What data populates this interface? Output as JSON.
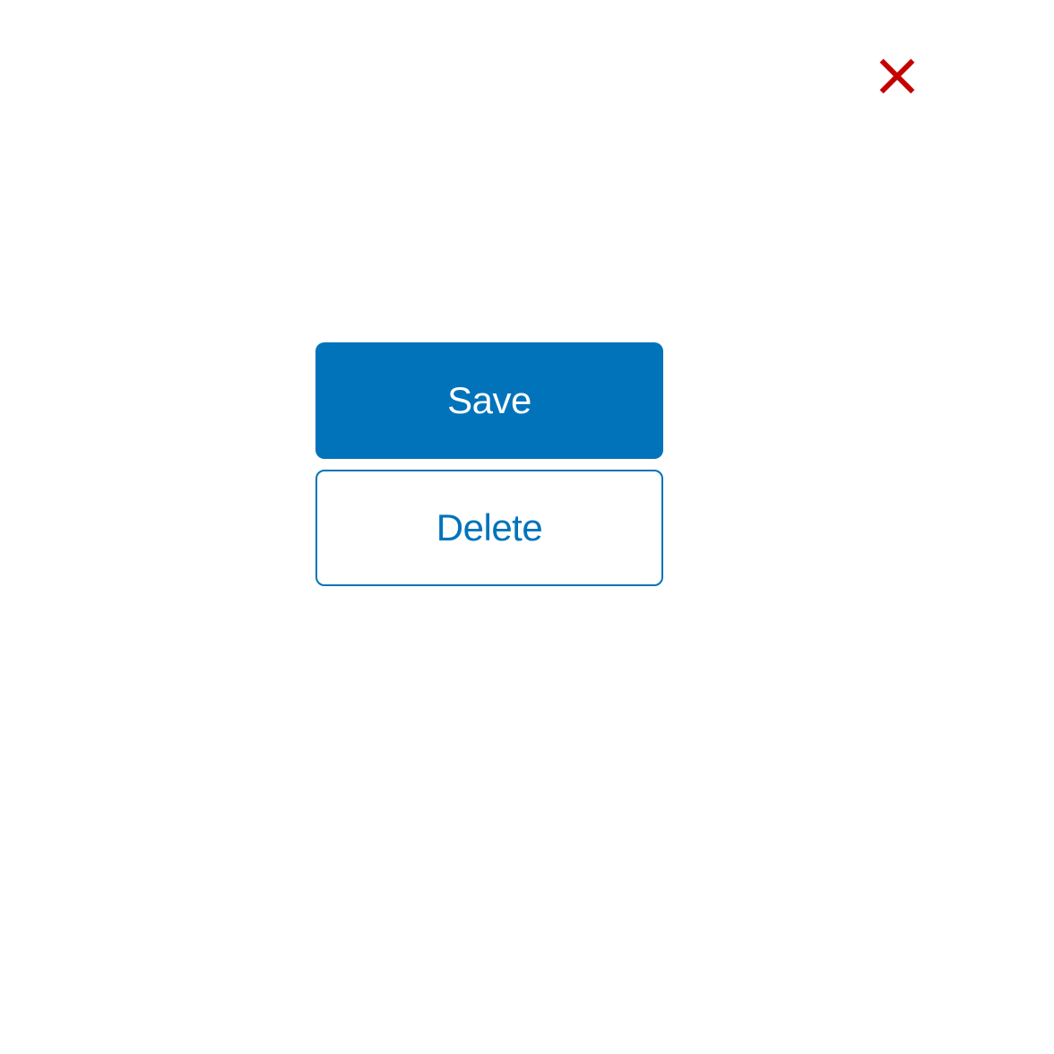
{
  "buttons": {
    "save_label": "Save",
    "delete_label": "Delete"
  },
  "colors": {
    "primary": "#0073bb",
    "close_icon": "#c40000"
  }
}
